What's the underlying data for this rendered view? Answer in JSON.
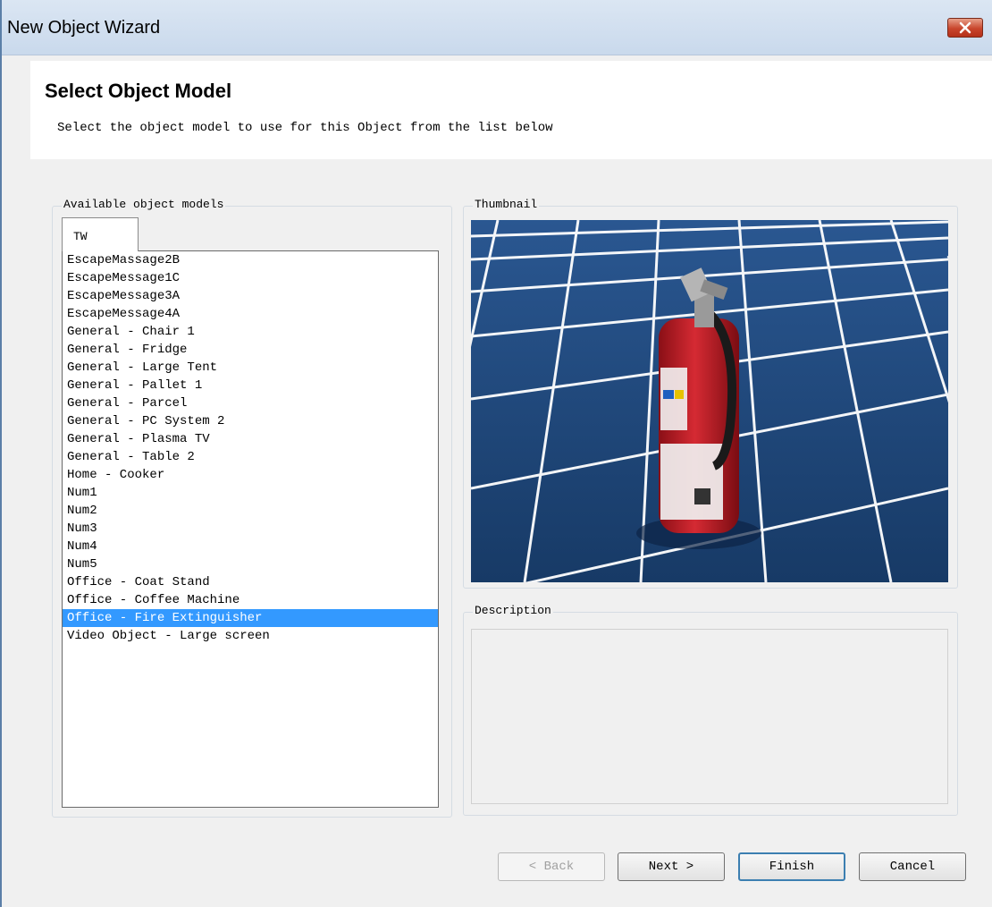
{
  "window": {
    "title": "New Object Wizard"
  },
  "header": {
    "title": "Select Object Model",
    "subtitle": "Select the object model to use for this Object from the list below"
  },
  "models_group": {
    "label": "Available object models",
    "tabs": [
      {
        "label": "TW"
      }
    ],
    "items": [
      "EscapeMassage2B",
      "EscapeMessage1C",
      "EscapeMessage3A",
      "EscapeMessage4A",
      "General - Chair 1",
      "General - Fridge",
      "General - Large Tent",
      "General - Pallet 1",
      "General - Parcel",
      "General - PC System 2",
      "General - Plasma TV",
      "General - Table 2",
      "Home - Cooker",
      "Num1",
      "Num2",
      "Num3",
      "Num4",
      "Num5",
      "Office - Coat Stand",
      "Office - Coffee Machine",
      "Office - Fire Extinguisher",
      "Video Object - Large screen"
    ],
    "selected_index": 20
  },
  "thumbnail_group": {
    "label": "Thumbnail",
    "image_icon": "fire-extinguisher-3d-preview"
  },
  "description_group": {
    "label": "Description",
    "text": ""
  },
  "buttons": {
    "back": "< Back",
    "next": "Next >",
    "finish": "Finish",
    "cancel": "Cancel"
  },
  "colors": {
    "selection": "#3399ff",
    "floor_tile": "#1d4270",
    "extinguisher_red": "#c8202a"
  }
}
